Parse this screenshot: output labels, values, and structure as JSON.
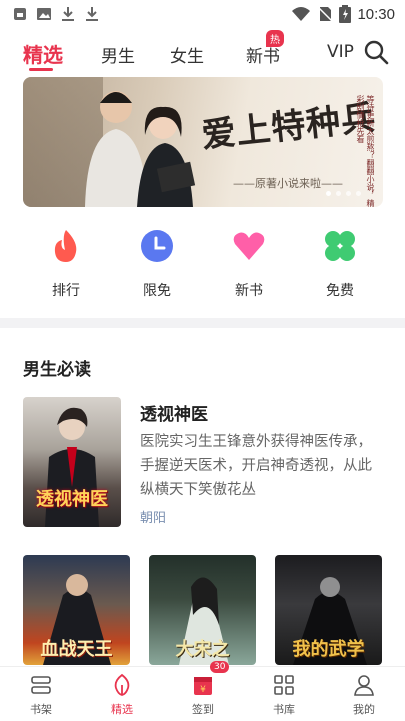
{
  "status_bar": {
    "time": "10:30",
    "left_icons": [
      "notification-icon",
      "image-icon",
      "download-icon",
      "download-icon"
    ],
    "right_icons": [
      "wifi-icon",
      "no-sim-icon",
      "battery-icon"
    ]
  },
  "nav": {
    "tabs": [
      {
        "label": "精选",
        "active": true
      },
      {
        "label": "男生",
        "active": false
      },
      {
        "label": "女生",
        "active": false
      },
      {
        "label": "新书",
        "active": false,
        "badge": "热"
      },
      {
        "label": "VIP",
        "active": false
      }
    ],
    "search_icon": "search-icon",
    "accent_color": "#e8344e"
  },
  "banner": {
    "title": "爱上特种兵",
    "subtitle": "——原著小说来啦——",
    "side_text": "等待更新太煎熬？翻翻小说，精彩剧情抢先看",
    "page_count": 4,
    "active_page": 1
  },
  "quick_entries": [
    {
      "label": "排行",
      "icon": "flame-icon",
      "color": "#ff5a4f"
    },
    {
      "label": "限免",
      "icon": "clock-icon",
      "color": "#5a78f0"
    },
    {
      "label": "新书",
      "icon": "heart-icon",
      "color": "#ff5fa8"
    },
    {
      "label": "免费",
      "icon": "clover-icon",
      "color": "#3fcb72"
    }
  ],
  "section": {
    "title": "男生必读",
    "featured": {
      "title": "透视神医",
      "description": "医院实习生王锋意外获得神医传承，手握逆天医术，开启神奇透视，从此纵横天下笑傲花丛",
      "author": "朝阳",
      "cover_caption": "透视神医"
    },
    "more_books": [
      {
        "cover_text": "血战天王"
      },
      {
        "cover_text": "大宋之"
      },
      {
        "cover_text": "我的武学"
      }
    ]
  },
  "bottom_nav": {
    "items": [
      {
        "label": "书架",
        "icon": "bookshelf-icon",
        "active": false
      },
      {
        "label": "精选",
        "icon": "featured-icon",
        "active": true
      },
      {
        "label": "签到",
        "icon": "checkin-icon",
        "active": false,
        "badge": "30"
      },
      {
        "label": "书库",
        "icon": "library-icon",
        "active": false
      },
      {
        "label": "我的",
        "icon": "profile-icon",
        "active": false
      }
    ]
  }
}
